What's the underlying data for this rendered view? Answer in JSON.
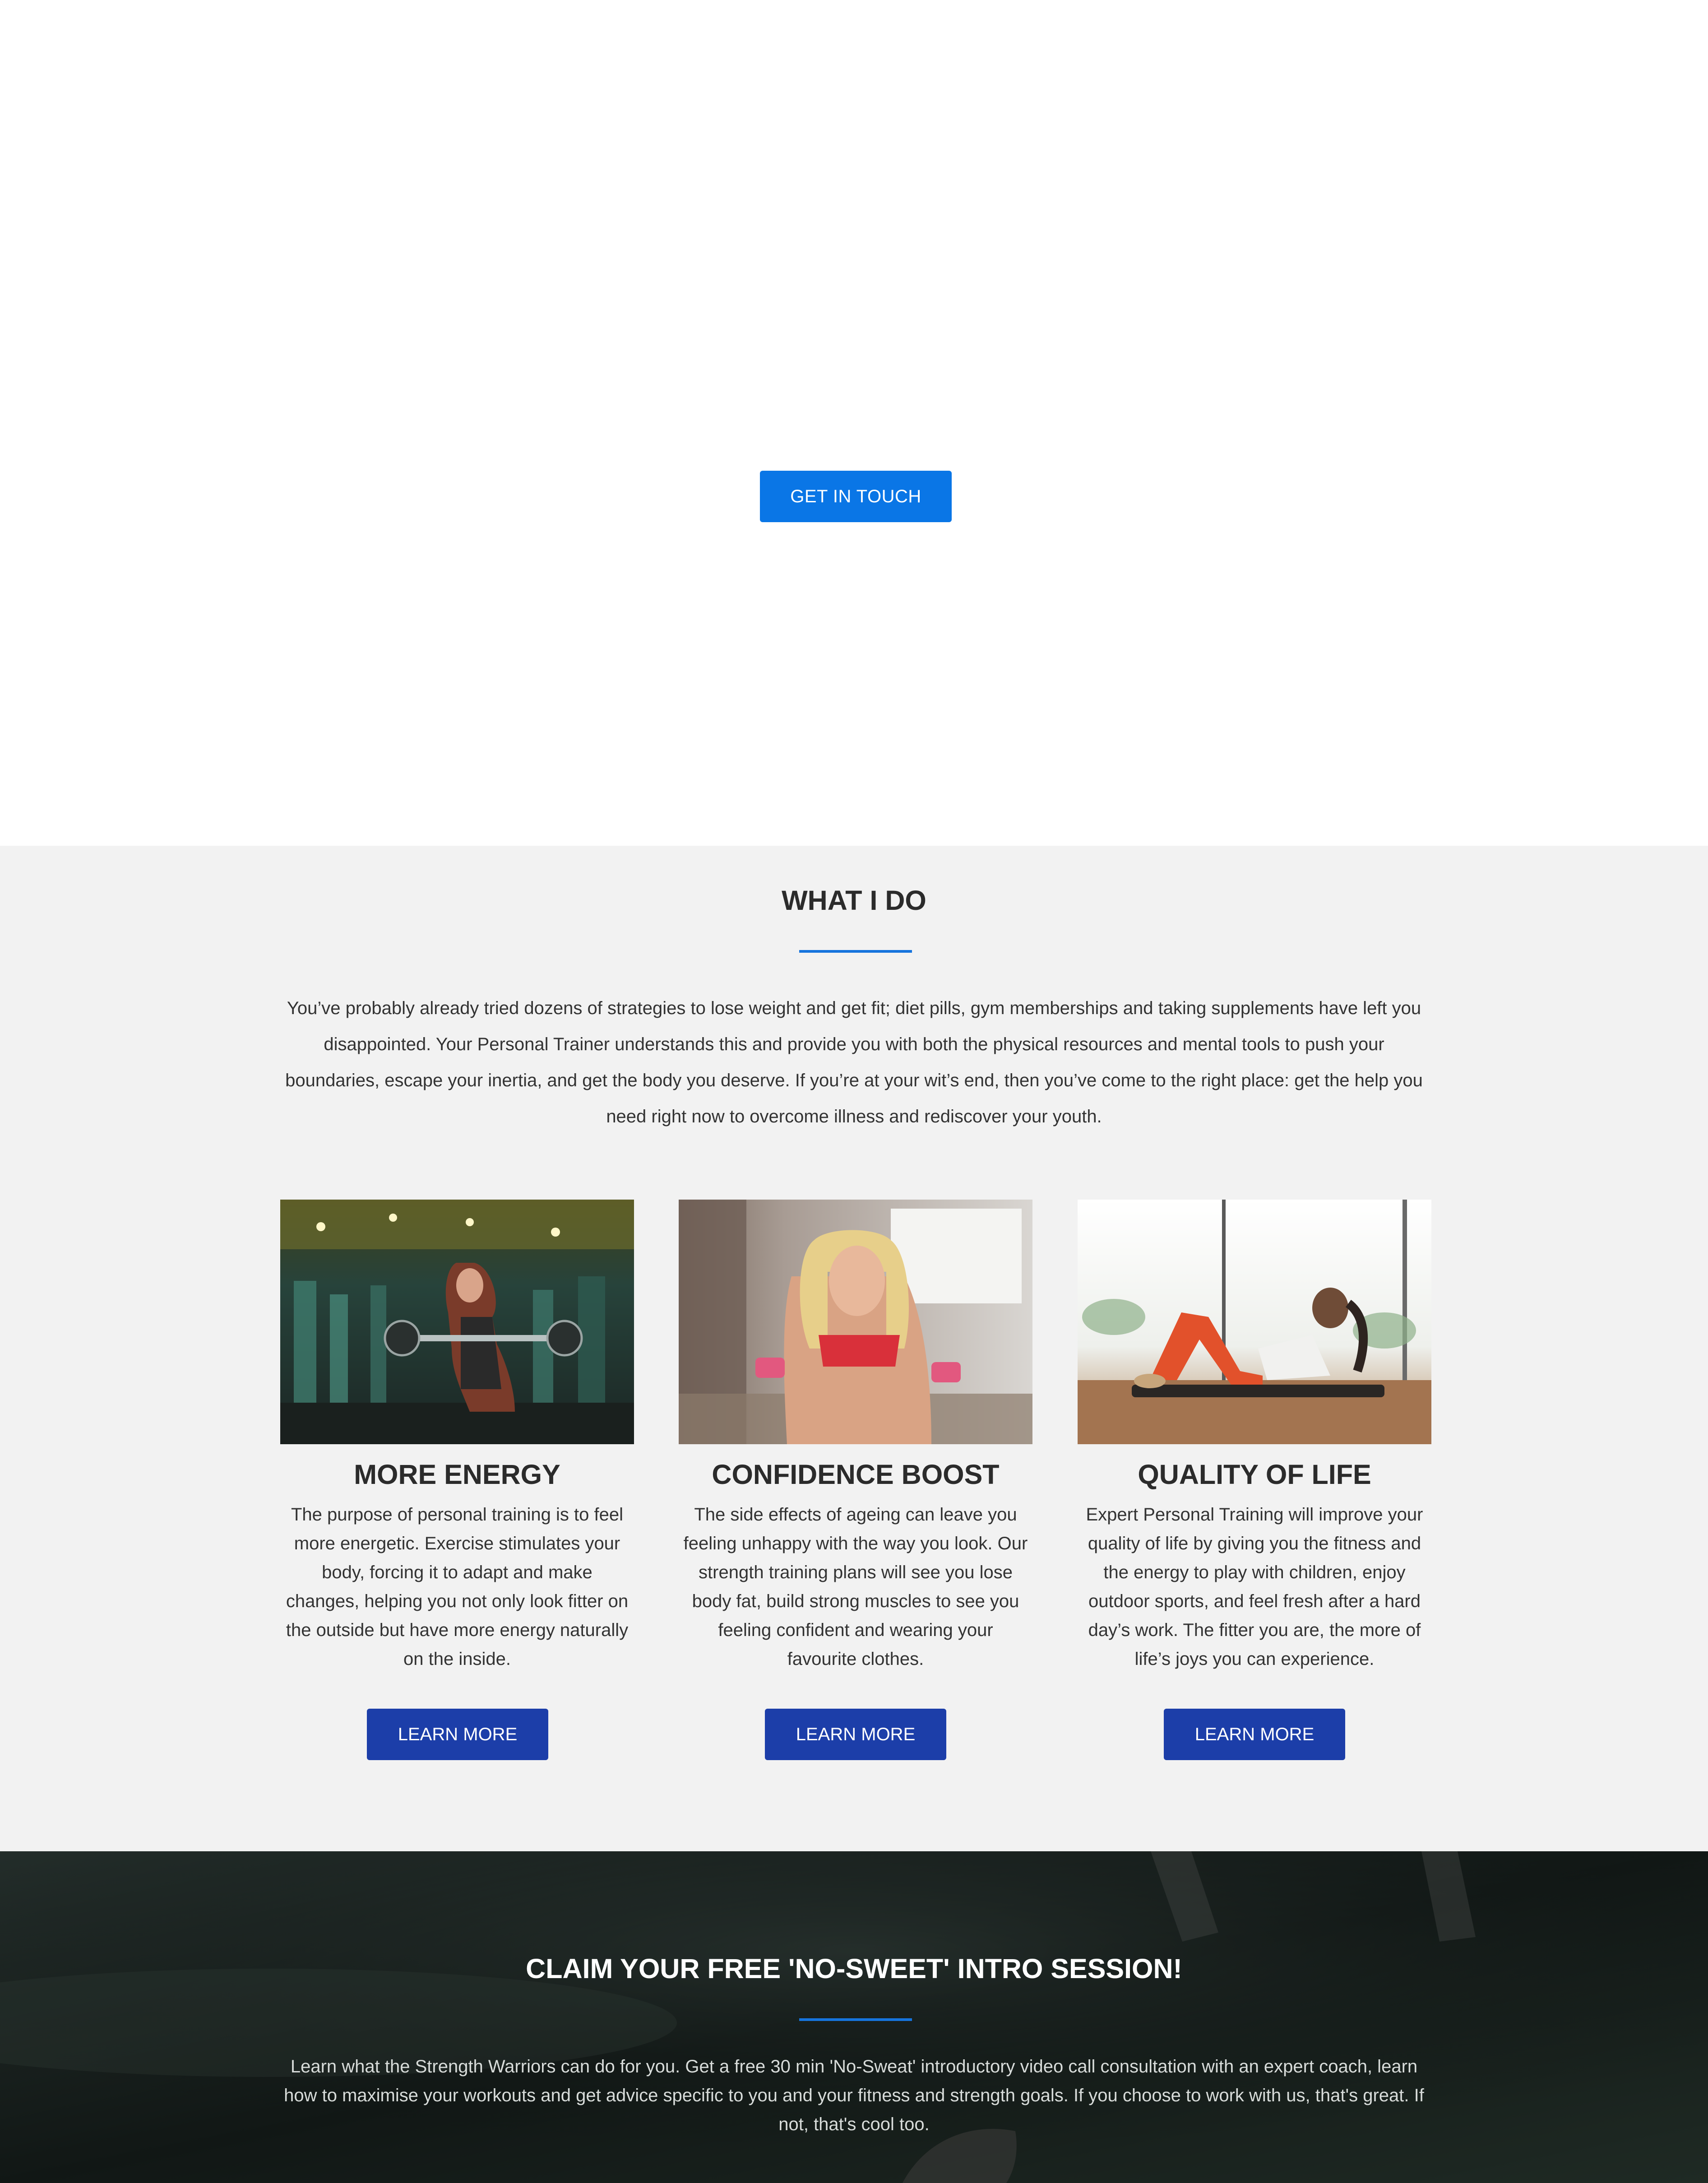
{
  "hero": {
    "cta_label": "GET IN TOUCH"
  },
  "services": {
    "title": "WHAT I DO",
    "intro": "You’ve probably already tried dozens of strategies to lose weight and get fit; diet pills, gym memberships and taking supplements have left you disappointed. Your Personal Trainer understands this and provide you with both the physical resources and mental tools to push your boundaries, escape your inertia, and get the body you deserve. If you’re at your wit’s end, then you’ve come to the right place: get the help you need right now to overcome illness and rediscover your youth.",
    "cards": [
      {
        "title": "MORE ENERGY",
        "text": "The purpose of personal training is to feel more energetic. Exercise stimulates your body, forcing it to adapt and make changes, helping you not only look fitter on the outside but have more energy naturally on the inside.",
        "button": "LEARN MORE"
      },
      {
        "title": "CONFIDENCE BOOST",
        "text": "The side effects of ageing can leave you feeling unhappy with the way you look. Our strength training plans will see you lose body fat, build strong muscles to see you feeling confident and wearing your favourite clothes.",
        "button": "LEARN MORE"
      },
      {
        "title": "QUALITY OF LIFE",
        "text": "Expert Personal Training will improve your quality of life by giving you the fitness and the energy to play with children, enjoy outdoor sports, and feel fresh after a hard day’s work. The fitter you are, the more of life’s joys you can experience.",
        "button": "LEARN MORE"
      }
    ]
  },
  "promo": {
    "title": "CLAIM YOUR FREE 'NO-SWEET' INTRO SESSION!",
    "text": "Learn what the Strength Warriors can do for you. Get a free 30 min 'No-Sweat' introductory video call consultation with an expert coach, learn how to maximise your workouts and get advice specific to you and your fitness and strength goals. If you choose to work with us, that's great. If not, that's cool too."
  },
  "colors": {
    "cta_blue": "#0a76e6",
    "learn_more_blue": "#1c3ea9",
    "accent_rule": "#1674dd",
    "section_bg": "#f2f2f2"
  }
}
